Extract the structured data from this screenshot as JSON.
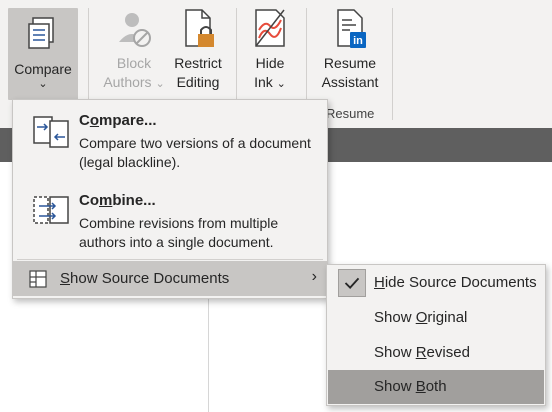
{
  "ribbon": {
    "compare": {
      "label": "Compare",
      "chevron": "⌄"
    },
    "block_authors": {
      "line1": "Block",
      "line2": "Authors",
      "chevron": "⌄"
    },
    "restrict_editing": {
      "line1": "Restrict",
      "line2": "Editing"
    },
    "hide_ink": {
      "line1": "Hide",
      "line2": "Ink",
      "chevron": "⌄"
    },
    "resume_assistant": {
      "line1": "Resume",
      "line2": "Assistant"
    },
    "group_resume_label": "Resume"
  },
  "compare_menu": {
    "compare_item": {
      "title_pre": "C",
      "title_u": "o",
      "title_post": "mpare...",
      "description": "Compare two versions of a document (legal blackline)."
    },
    "combine_item": {
      "title_pre": "Co",
      "title_u": "m",
      "title_post": "bine...",
      "description": "Combine revisions from multiple authors into a single document."
    },
    "show_source_item": {
      "label_u": "S",
      "label_post": "how Source Documents",
      "arrow": "›"
    }
  },
  "source_submenu": {
    "items": [
      {
        "pre": "",
        "u": "H",
        "post": "ide Source Documents",
        "checked": true
      },
      {
        "pre": "Show ",
        "u": "O",
        "post": "riginal",
        "checked": false
      },
      {
        "pre": "Show ",
        "u": "R",
        "post": "evised",
        "checked": false
      },
      {
        "pre": "Show ",
        "u": "B",
        "post": "oth",
        "checked": false,
        "highlighted": true
      }
    ]
  },
  "icons": {
    "compare": "compare-documents-icon",
    "block_authors": "block-authors-icon",
    "restrict_editing": "lock-document-icon",
    "hide_ink": "hide-ink-icon",
    "resume_assistant": "resume-assistant-icon",
    "compare_item": "compare-versions-icon",
    "combine_item": "combine-documents-icon",
    "show_source": "source-documents-icon",
    "submenu_arrow": "chevron-right-icon",
    "check": "checkmark-icon"
  },
  "colors": {
    "ribbon_bg": "#f3f2f1",
    "selected_bg": "#c8c6c4",
    "highlight_bg": "#a19f9d",
    "linkedin_blue": "#0a66c2",
    "lock_orange": "#d4882e",
    "ink_red": "#e74c3c"
  }
}
